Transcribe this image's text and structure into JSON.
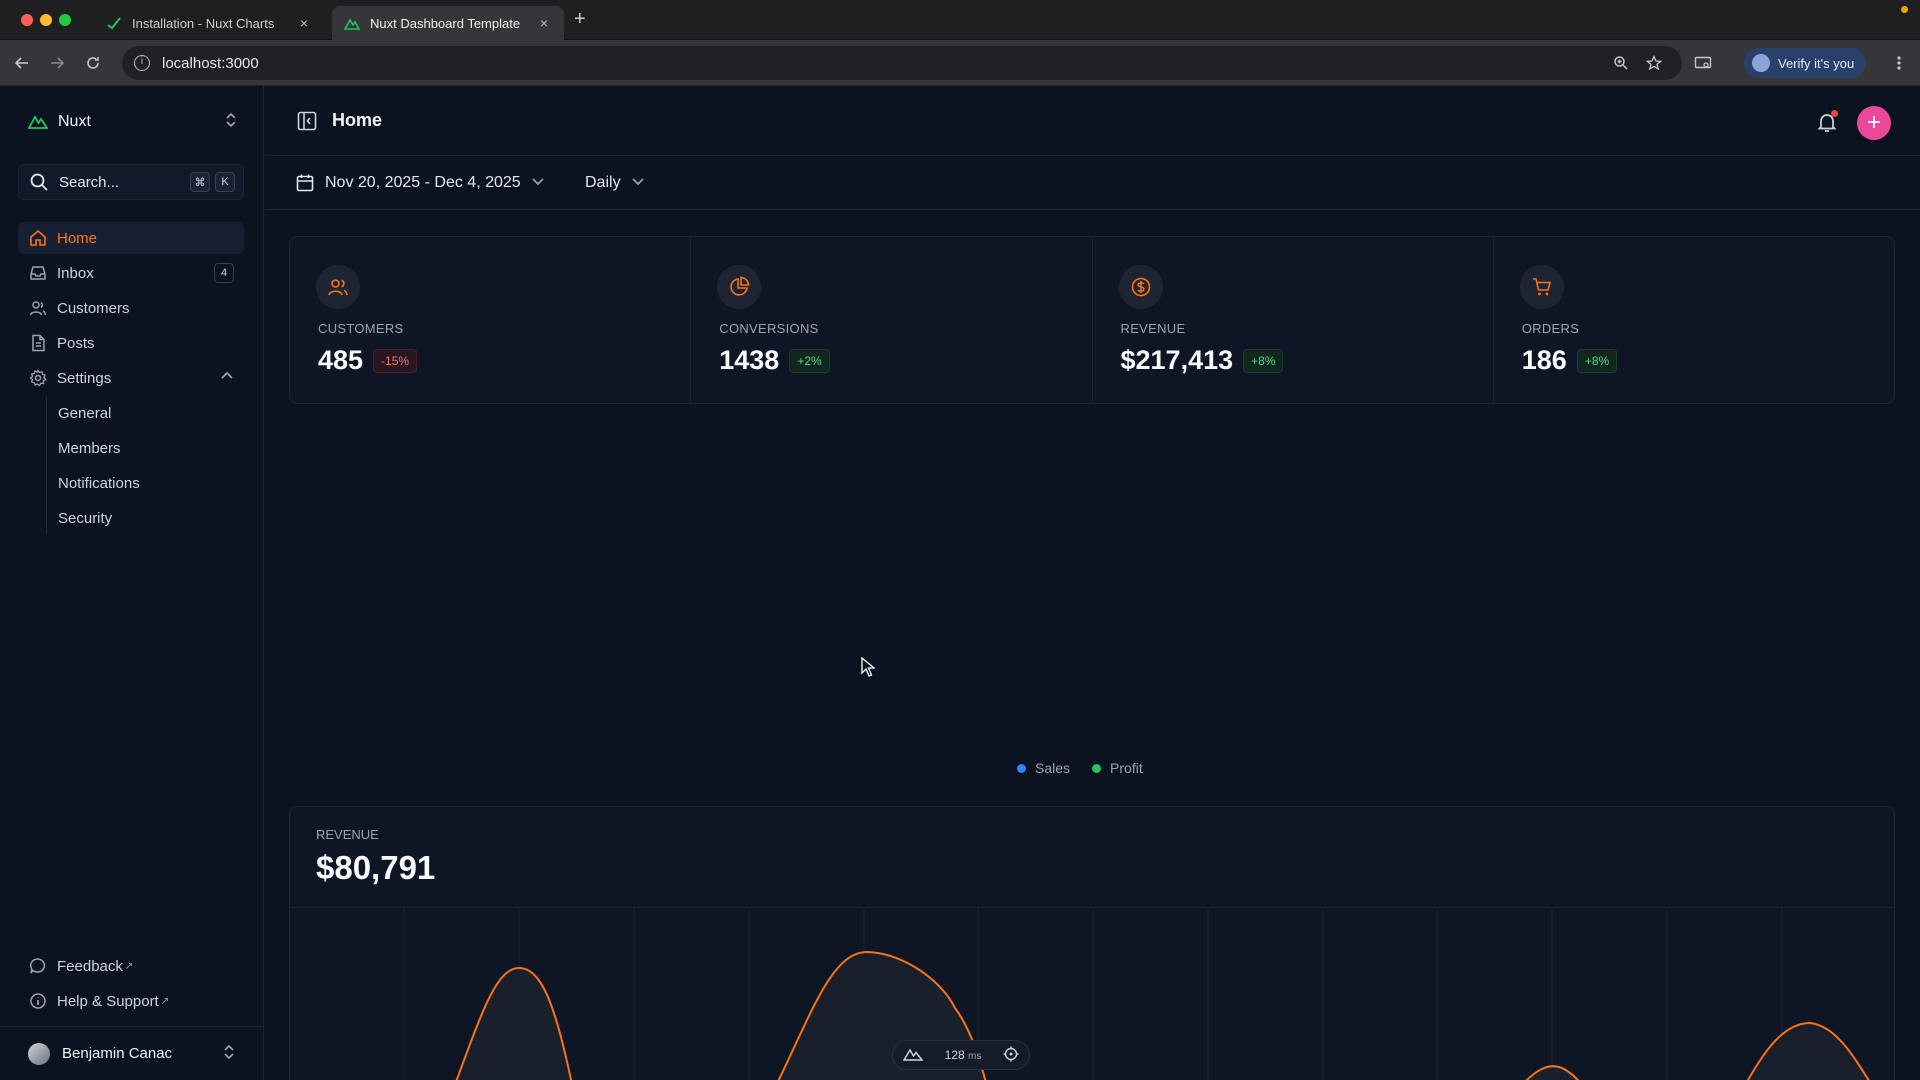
{
  "browser": {
    "tabs": [
      {
        "label": "Installation - Nuxt Charts"
      },
      {
        "label": "Nuxt Dashboard Template"
      }
    ],
    "close_glyph": "×",
    "new_tab_glyph": "+",
    "url": "localhost:3000",
    "profile_label": "Verify it's you"
  },
  "sidebar": {
    "brand": "Nuxt",
    "search_label": "Search...",
    "search_keys": [
      "⌘",
      "K"
    ],
    "items": [
      {
        "label": "Home",
        "icon": "home-icon",
        "active": true
      },
      {
        "label": "Inbox",
        "icon": "inbox-icon",
        "badge": "4"
      },
      {
        "label": "Customers",
        "icon": "users-icon"
      },
      {
        "label": "Posts",
        "icon": "file-icon"
      },
      {
        "label": "Settings",
        "icon": "gear-icon",
        "expanded": true
      }
    ],
    "settings_sub": [
      "General",
      "Members",
      "Notifications",
      "Security"
    ],
    "footer": [
      {
        "label": "Feedback",
        "icon": "message-icon",
        "ext": "↗"
      },
      {
        "label": "Help & Support",
        "icon": "info-icon",
        "ext": "↗"
      }
    ],
    "user": "Benjamin Canac"
  },
  "header": {
    "title": "Home"
  },
  "toolbar": {
    "date_range": "Nov 20, 2025 - Dec 4, 2025",
    "period": "Daily"
  },
  "stats": [
    {
      "label": "CUSTOMERS",
      "value": "485",
      "change": "-15%",
      "trend": "negative",
      "icon": "users-icon"
    },
    {
      "label": "CONVERSIONS",
      "value": "1438",
      "change": "+2%",
      "trend": "positive",
      "icon": "pie-chart-icon"
    },
    {
      "label": "REVENUE",
      "value": "$217,413",
      "change": "+8%",
      "trend": "positive",
      "icon": "dollar-icon"
    },
    {
      "label": "ORDERS",
      "value": "186",
      "change": "+8%",
      "trend": "positive",
      "icon": "cart-icon"
    }
  ],
  "legend": [
    {
      "label": "Sales",
      "color": "#3b82f6"
    },
    {
      "label": "Profit",
      "color": "#22c55e"
    }
  ],
  "revenue": {
    "label": "REVENUE",
    "value": "$80,791"
  },
  "devtools": {
    "timing": "128",
    "unit": "ms"
  },
  "colors": {
    "accent": "#f97316",
    "primary_button": "#ec4899",
    "line": "#f97316"
  }
}
